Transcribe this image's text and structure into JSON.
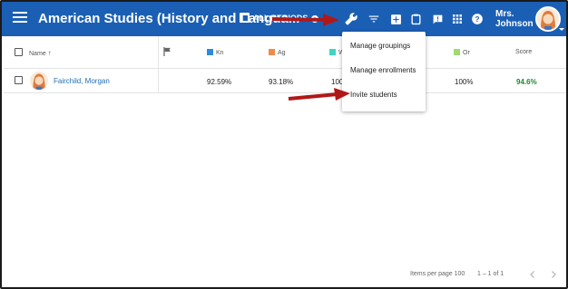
{
  "header": {
    "title": "American Studies (History and Langua...",
    "periods_label": "ALL PERIODS",
    "user_name_line1": "Mrs.",
    "user_name_line2": "Johnson",
    "bar_color": "#1a5fb4"
  },
  "table": {
    "columns": [
      {
        "label": "Name"
      },
      {
        "label": ""
      },
      {
        "label": "Kn",
        "color": "#2a8ce0"
      },
      {
        "label": "Ag",
        "color": "#f08a4b"
      },
      {
        "label": "W",
        "color": "#3fd4c4"
      },
      {
        "label": "Or",
        "color": "#9ddc6e"
      },
      {
        "label": "Score"
      }
    ],
    "rows": [
      {
        "name": "Fairchild, Morgan",
        "kn": "92.59%",
        "ag": "93.18%",
        "w": "100",
        "or": "100%",
        "score": "94.6%"
      }
    ]
  },
  "dropdown": {
    "items": [
      "Manage groupings",
      "Manage enrollments",
      "Invite students"
    ]
  },
  "footer": {
    "items_per_page": "Items per page 100",
    "range": "1 – 1 of 1"
  },
  "icons": [
    "menu-icon",
    "calendar-icon",
    "settings-icon",
    "wrench-icon",
    "filter-icon",
    "add-icon",
    "clipboard-icon",
    "alert-icon",
    "apps-icon",
    "help-icon",
    "flag-icon",
    "sort-arrow-icon",
    "chevron-left-icon",
    "chevron-right-icon"
  ]
}
